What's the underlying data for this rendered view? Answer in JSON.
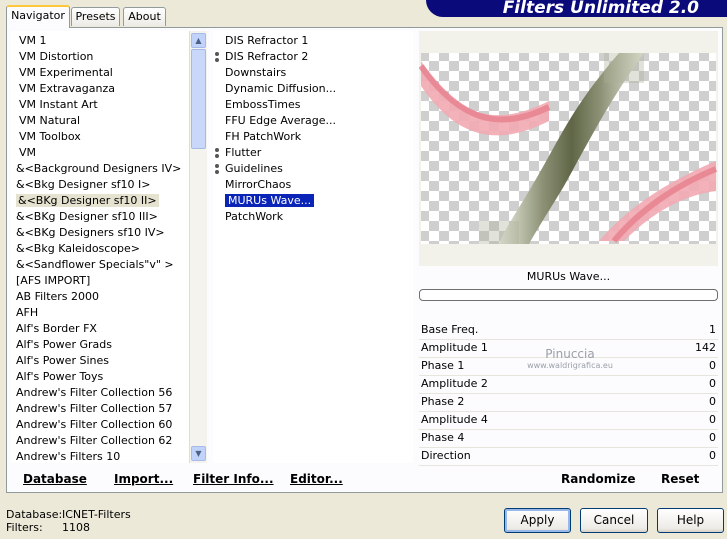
{
  "tabs": [
    "Navigator",
    "Presets",
    "About"
  ],
  "brand": "Filters Unlimited 2.0",
  "categories": [
    "VM 1",
    "VM Distortion",
    "VM Experimental",
    "VM Extravaganza",
    "VM Instant Art",
    "VM Natural",
    "VM Toolbox",
    "VM",
    "&<Background Designers IV>",
    "&<Bkg Designer sf10 I>",
    "&<BKg Designer sf10 II>",
    "&<BKg Designer sf10 III>",
    "&<BKg Designers sf10 IV>",
    "&<Bkg Kaleidoscope>",
    "&<Sandflower Specials\"v\" >",
    "[AFS IMPORT]",
    "AB Filters 2000",
    "AFH",
    "Alf's Border FX",
    "Alf's Power Grads",
    "Alf's Power Sines",
    "Alf's Power Toys",
    "Andrew's Filter Collection 56",
    "Andrew's Filter Collection 57",
    "Andrew's Filter Collection 60",
    "Andrew's Filter Collection 62",
    "Andrew's Filters 10"
  ],
  "filters": [
    "DIS Refractor 1",
    "DIS Refractor 2",
    "Downstairs",
    "Dynamic Diffusion...",
    "EmbossTimes",
    "FFU Edge Average...",
    "FH PatchWork",
    "Flutter",
    "Guidelines",
    "MirrorChaos",
    "MURUs Wave...",
    "PatchWork"
  ],
  "filter_title": "MURUs Wave...",
  "watermark_title": "Pinuccia",
  "watermark_url": "www.waldrigrafica.eu",
  "params": [
    {
      "label": "Base Freq.",
      "value": "1"
    },
    {
      "label": "Amplitude 1",
      "value": "142"
    },
    {
      "label": "Phase 1",
      "value": "0"
    },
    {
      "label": "Amplitude 2",
      "value": "0"
    },
    {
      "label": "Phase 2",
      "value": "0"
    },
    {
      "label": "Amplitude 4",
      "value": "0"
    },
    {
      "label": "Phase 4",
      "value": "0"
    },
    {
      "label": "Direction",
      "value": "0"
    }
  ],
  "toolbar": {
    "database": "Database",
    "import": "Import...",
    "filter_info": "Filter Info...",
    "editor": "Editor...",
    "randomize": "Randomize",
    "reset": "Reset"
  },
  "status": {
    "database_label": "Database:",
    "database_value": "ICNET-Filters",
    "filters_label": "Filters:",
    "filters_value": "1108"
  },
  "buttons": {
    "apply": "Apply",
    "cancel": "Cancel",
    "help": "Help"
  },
  "colors": {
    "selection": "#0a24b8",
    "brand_bg": "#0a0a7a",
    "tab_accent": "#ffc83c"
  }
}
